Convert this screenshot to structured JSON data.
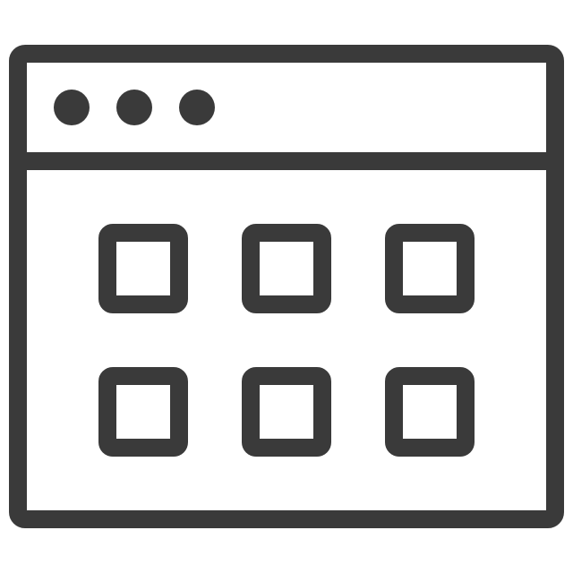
{
  "icon": {
    "name": "app-window-grid-icon",
    "stroke_color": "#3a3a3a",
    "background_color": "#ffffff"
  },
  "window": {
    "title_bar_dots": [
      {
        "name": "window-dot-1"
      },
      {
        "name": "window-dot-2"
      },
      {
        "name": "window-dot-3"
      }
    ],
    "grid": {
      "rows": 2,
      "columns": 3,
      "tiles": [
        {
          "name": "grid-tile-1"
        },
        {
          "name": "grid-tile-2"
        },
        {
          "name": "grid-tile-3"
        },
        {
          "name": "grid-tile-4"
        },
        {
          "name": "grid-tile-5"
        },
        {
          "name": "grid-tile-6"
        }
      ]
    }
  }
}
